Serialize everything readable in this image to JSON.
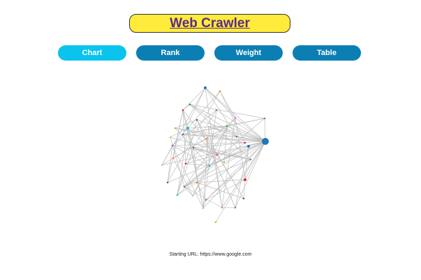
{
  "header": {
    "title": "Web Crawler"
  },
  "tabs": [
    {
      "label": "Chart",
      "color": "#0bc4ee",
      "active": true
    },
    {
      "label": "Rank",
      "color": "#0b7fb4",
      "active": false
    },
    {
      "label": "Weight",
      "color": "#0b7fb4",
      "active": false
    },
    {
      "label": "Table",
      "color": "#0b7fb4",
      "active": false
    }
  ],
  "footer": {
    "starting_url": "Starting URL: https://www.google.com"
  },
  "graph": {
    "edge_color": "#bdbdbd",
    "root_color": "#1f77b4",
    "node_palette": [
      "#1f77b4",
      "#ff7f0e",
      "#2ca02c",
      "#d62728",
      "#9467bd",
      "#8c564b",
      "#e377c2",
      "#7f7f7f",
      "#bcbd22",
      "#17becf",
      "#aec7e8",
      "#98df8a"
    ]
  }
}
